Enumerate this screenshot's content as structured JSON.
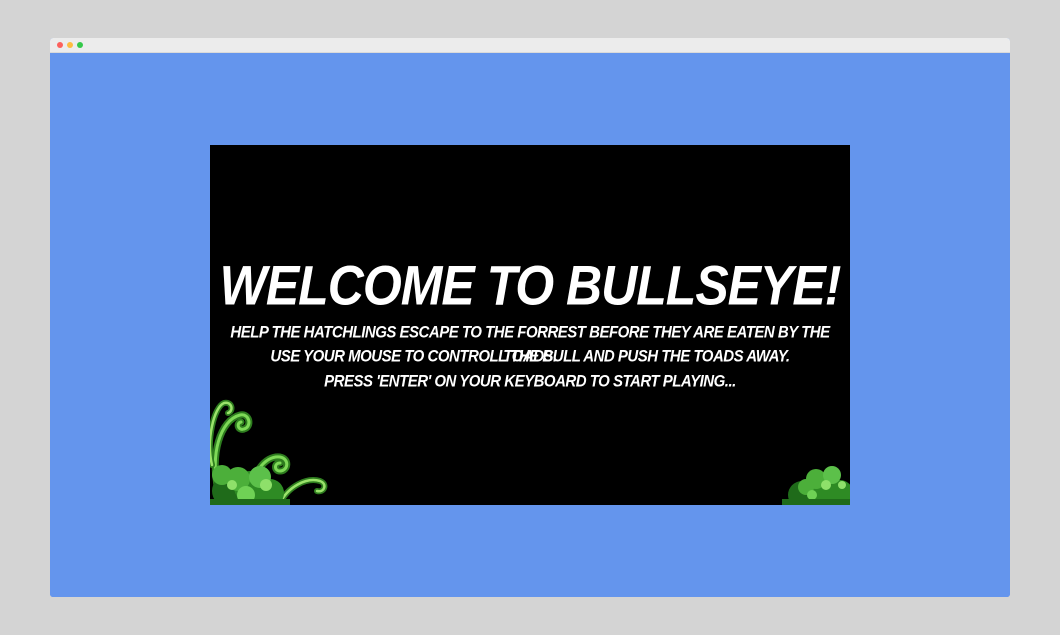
{
  "game": {
    "title": "WELCOME TO BULLSEYE!",
    "instructions": [
      "HELP THE HATCHLINGS ESCAPE TO THE FORREST BEFORE THEY ARE EATEN BY THE TOADS.",
      "USE YOUR MOUSE TO CONTROLL THE BULL AND PUSH THE TOADS AWAY.",
      "PRESS 'ENTER' ON YOUR KEYBOARD TO START PLAYING..."
    ]
  },
  "colors": {
    "page_background": "#6495ed",
    "game_background": "#000000",
    "text": "#ffffff",
    "foliage_dark": "#2e7d1f",
    "foliage_light": "#7ed957"
  },
  "icons": {
    "left_decoration": "fern-bush",
    "right_decoration": "bush"
  }
}
